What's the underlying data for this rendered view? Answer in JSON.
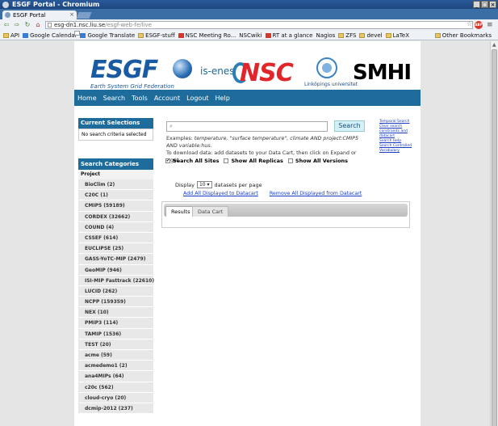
{
  "window": {
    "title": "ESGF Portal - Chromium"
  },
  "tabs": [
    {
      "label": "ESGF Portal"
    }
  ],
  "address": {
    "host": "esg-dn1.nsc.liu.se",
    "path": "/esgf-web-fe/live"
  },
  "bookmarks": [
    "API",
    "Google Calendar",
    "Google Translate",
    "ESGF-stuff",
    "NSC Meeting Ro...",
    "NSCwiki",
    "RT at a glance",
    "Nagios",
    "ZFS",
    "devel",
    "LaTeX"
  ],
  "other_bookmarks": "Other Bookmarks",
  "banner": {
    "esgf": "ESGF",
    "esgf_sub": "Earth System Grid Federation",
    "isenes": "is-enes",
    "nsc": "NSC",
    "liu": "Linköpings universitet",
    "smhi": "SMHI"
  },
  "nav": [
    "Home",
    "Search",
    "Tools",
    "Account",
    "Logout",
    "Help"
  ],
  "current_selections": {
    "title": "Current Selections",
    "body": "No search criteria selected"
  },
  "search_categories": {
    "title": "Search Categories",
    "facet": "Project",
    "items": [
      "BioClim (2)",
      "C20C (1)",
      "CMIP5 (59189)",
      "CORDEX (32662)",
      "COUND (4)",
      "CSSEF (614)",
      "EUCLIPSE (25)",
      "GASS-YoTC-MIP (2479)",
      "GeoMIP (946)",
      "ISI-MIP Fasttrack (22610)",
      "LUCID (262)",
      "NCPP (159359)",
      "NEX (10)",
      "PMIP3 (114)",
      "TAMIP (1536)",
      "TEST (20)",
      "acme (59)",
      "acmedemo1 (2)",
      "ana4MIPs (64)",
      "c20c (562)",
      "cloud-cryo (20)",
      "dcmip-2012 (237)"
    ]
  },
  "search": {
    "placeholder": "",
    "button": "Search",
    "examples_prefix": "Examples: ",
    "examples_italic": "temperature, \"surface temperature\", climate AND project:CMIP5 AND variable:hus.",
    "download_hint": "To download data: add datasets to your Data Cart, then click on Expand or wget."
  },
  "side_links": [
    "Temporal Search",
    "Clear search constraints and datacart",
    "Search Help",
    "Search Controlled Vocabulary"
  ],
  "options": {
    "all_sites": "Search All Sites",
    "all_replicas": "Show All Replicas",
    "all_versions": "Show All Versions"
  },
  "display": {
    "prefix": "Display",
    "value": "10",
    "suffix": "datasets per page"
  },
  "add_links": {
    "add": "Add All Displayed to Datacart",
    "remove": "Remove All Displayed from Datacart"
  },
  "result_tabs": {
    "results": "Results",
    "cart": "Data Cart"
  }
}
